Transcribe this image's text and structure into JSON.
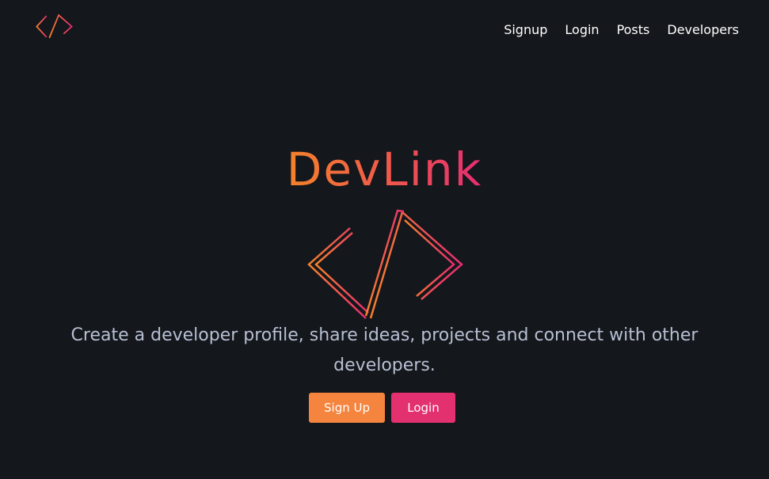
{
  "header": {
    "logo_icon": "code-brackets-icon",
    "nav": [
      "Signup",
      "Login",
      "Posts",
      "Developers"
    ]
  },
  "hero": {
    "title": "DevLink",
    "logo_icon": "code-brackets-icon",
    "tagline": "Create a developer profile, share ideas, projects and connect with other developers.",
    "buttons": {
      "signup": "Sign Up",
      "login": "Login"
    }
  },
  "colors": {
    "background": "#14171b",
    "gradient_start": "#f5822c",
    "gradient_end": "#e52d72",
    "signup_button": "#f5843e",
    "login_button": "#e3306f",
    "tagline": "#b7bfd3"
  }
}
